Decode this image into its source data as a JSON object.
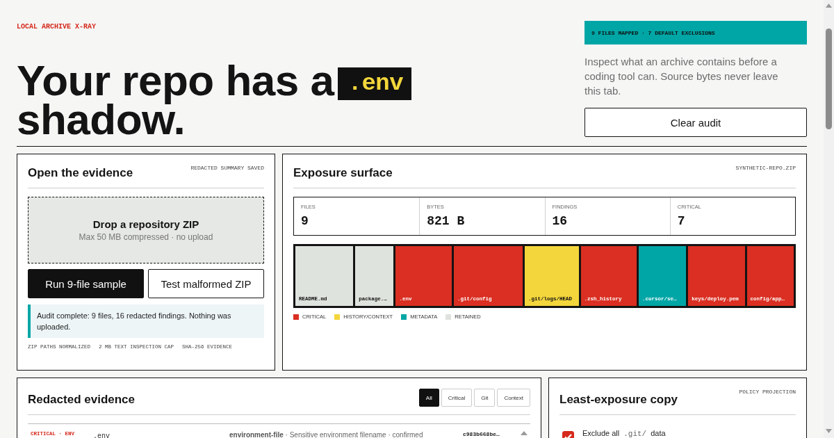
{
  "header": {
    "kicker": "LOCAL ARCHIVE X-RAY",
    "title_before": "Your repo has a",
    "title_code": ".env",
    "title_after": "shadow.",
    "band": "9 FILES MAPPED · 7 DEFAULT EXCLUSIONS",
    "intro": "Inspect what an archive contains before a coding tool can. Source bytes never leave this tab.",
    "clear_button": "Clear audit"
  },
  "evidence_panel": {
    "title": "Open the evidence",
    "tag": "REDACTED SUMMARY SAVED",
    "drop_title": "Drop a repository ZIP",
    "drop_hint": "Max 50 MB compressed · no upload",
    "buttons": [
      {
        "label": "Run 9-file sample",
        "kind": "primary"
      },
      {
        "label": "Test malformed ZIP",
        "kind": "secondary"
      }
    ],
    "status": "Audit complete: 9 files, 16 redacted findings. Nothing was uploaded.",
    "notes": [
      "ZIP PATHS NORMALIZED",
      "2 MB TEXT INSPECTION CAP",
      "SHA-256 EVIDENCE"
    ]
  },
  "exposure_panel": {
    "title": "Exposure surface",
    "tag": "SYNTHETIC-REPO.ZIP",
    "stats": [
      {
        "label": "FILES",
        "value": "9"
      },
      {
        "label": "BYTES",
        "value": "821 B"
      },
      {
        "label": "FINDINGS",
        "value": "16"
      },
      {
        "label": "CRITICAL",
        "value": "7"
      }
    ],
    "tiles": [
      {
        "name": "README.md",
        "kind": "retained",
        "color": "#dfe3dd"
      },
      {
        "name": "package.…",
        "kind": "retained",
        "color": "#dfe3dd"
      },
      {
        "name": ".env",
        "kind": "critical",
        "color": "#da2f22"
      },
      {
        "name": ".git/config",
        "kind": "critical",
        "color": "#da2f22"
      },
      {
        "name": ".git/logs/HEAD",
        "kind": "history",
        "color": "#f3d63b"
      },
      {
        "name": ".zsh_history",
        "kind": "critical",
        "color": "#da2f22"
      },
      {
        "name": ".cursor/se…",
        "kind": "metadata",
        "color": "#00a6a6"
      },
      {
        "name": "keys/deploy.pem",
        "kind": "critical",
        "color": "#da2f22"
      },
      {
        "name": "config/app…",
        "kind": "critical",
        "color": "#da2f22"
      }
    ],
    "legend": [
      {
        "label": "CRITICAL",
        "color": "#da2f22"
      },
      {
        "label": "HISTORY/CONTEXT",
        "color": "#f3d63b"
      },
      {
        "label": "METADATA",
        "color": "#00a6a6"
      },
      {
        "label": "RETAINED",
        "color": "#dfe3dd"
      }
    ]
  },
  "redacted_panel": {
    "title": "Redacted evidence",
    "filters": [
      {
        "label": "All",
        "selected": true
      },
      {
        "label": "Critical",
        "selected": false
      },
      {
        "label": "Git",
        "selected": false
      },
      {
        "label": "Context",
        "selected": false
      }
    ],
    "rows": [
      {
        "severity": "CRITICAL · ENV",
        "path": ".env",
        "rule": "environment-file",
        "detail": " · Sensitive environment filename · confirmed",
        "hash": "c983b668be…"
      }
    ]
  },
  "copy_panel": {
    "title": "Least-exposure copy",
    "tag": "POLICY PROJECTION",
    "options": [
      {
        "before": "Exclude all",
        "code": ".git/",
        "after": "data",
        "checked": true
      }
    ]
  }
}
